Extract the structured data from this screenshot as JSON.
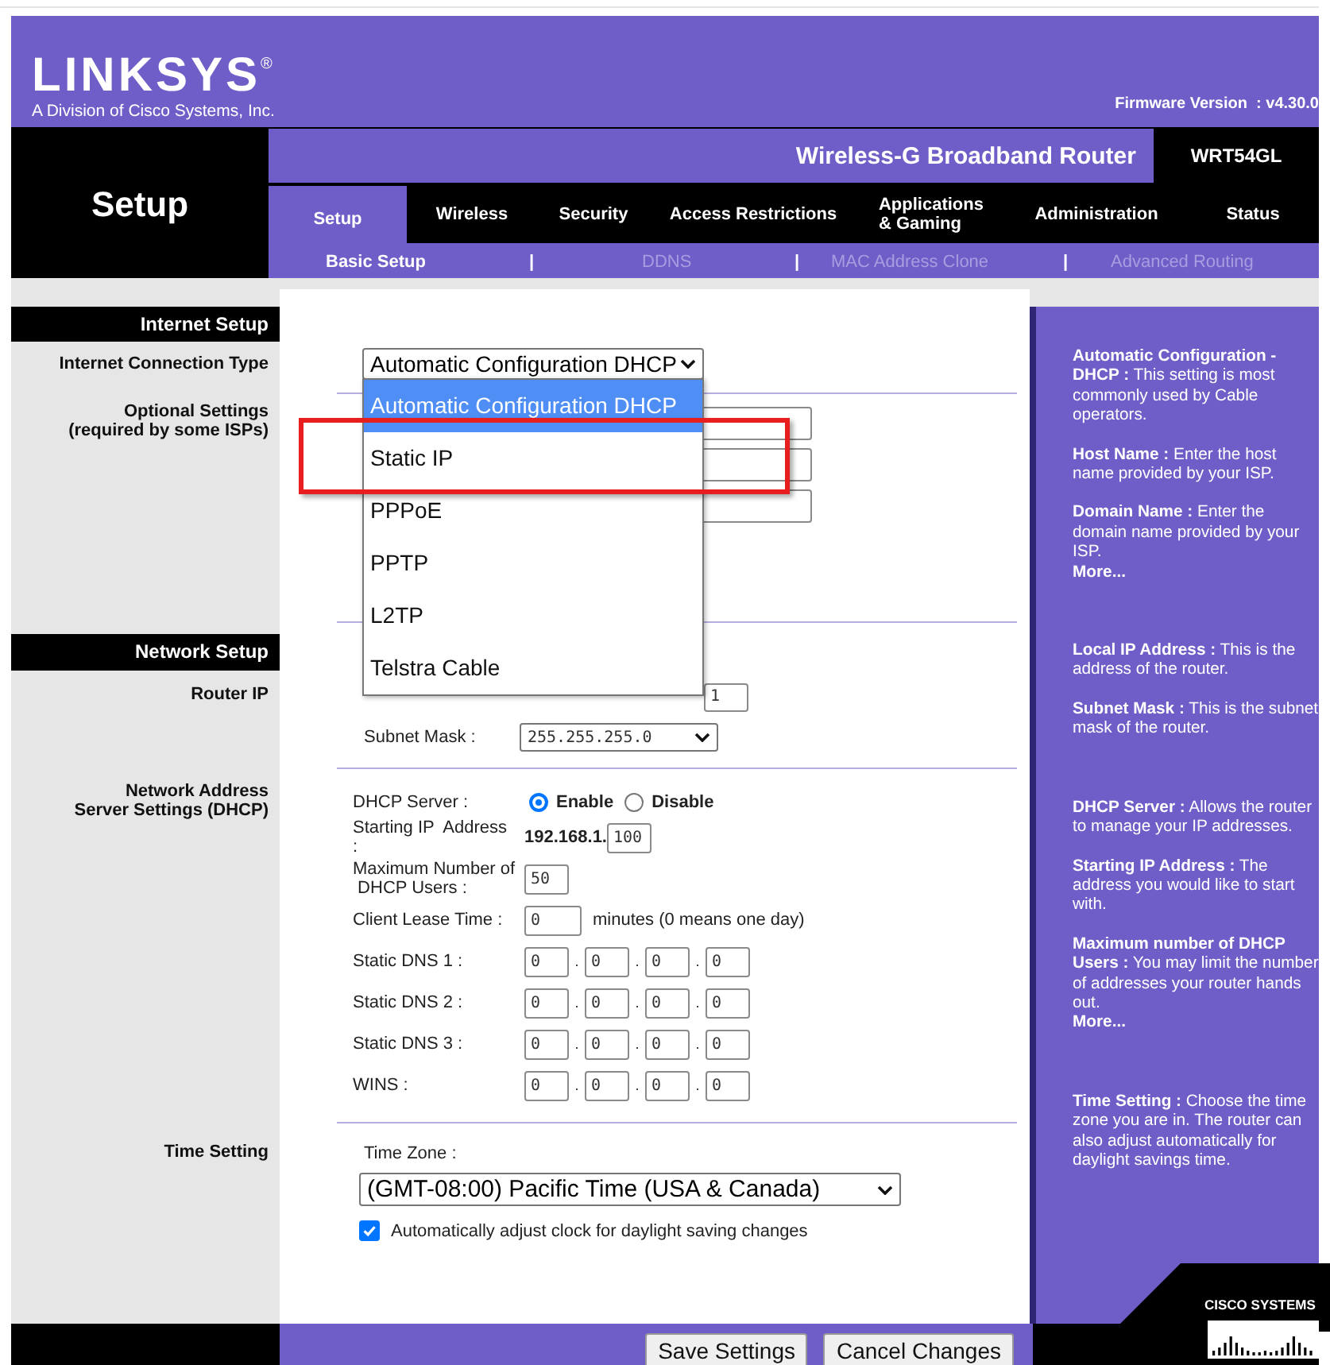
{
  "header": {
    "logo": "LINKSYS$^{®}$",
    "tagline": "A Division of Cisco Systems, Inc.",
    "firmware": "Firmware Version  : v4.30.0"
  },
  "page_title": "Setup",
  "product": {
    "name": "Wireless-G Broadband Router",
    "model": "WRT54GL"
  },
  "tabs": [
    {
      "label": "Setup",
      "selected": true
    },
    {
      "label": "Wireless",
      "selected": false
    },
    {
      "label": "Security",
      "selected": false
    },
    {
      "label": "Access Restrictions",
      "selected": false
    },
    {
      "label": "Applications\n& Gaming",
      "selected": false
    },
    {
      "label": "Administration",
      "selected": false
    },
    {
      "label": "Status",
      "selected": false
    }
  ],
  "subtabs": [
    {
      "label": "Basic Setup",
      "selected": true
    },
    {
      "label": "DDNS",
      "selected": false
    },
    {
      "label": "MAC Address Clone",
      "selected": false
    },
    {
      "label": "Advanced Routing",
      "selected": false
    }
  ],
  "subtab_separators": [
    "|",
    "|",
    "|"
  ],
  "internet_setup": {
    "heading": "Internet Setup",
    "connection_type_label": "Internet Connection Type",
    "optional_label": "Optional Settings\n(required by some ISPs)",
    "connection_type": {
      "value": "Automatic Configuration DHCP",
      "expanded": true,
      "options": [
        {
          "label": "Automatic Configuration DHCP",
          "selected": true
        },
        {
          "label": "Static IP",
          "selected": false
        },
        {
          "label": "PPPoE",
          "selected": false
        },
        {
          "label": "PPTP",
          "selected": false
        },
        {
          "label": "L2TP",
          "selected": false
        },
        {
          "label": "Telstra Cable",
          "selected": false
        }
      ]
    },
    "optional_fields": [
      {
        "kind": "text"
      },
      {
        "kind": "text"
      },
      {
        "kind": "text"
      }
    ]
  },
  "annotation": {
    "kind": "rectangle"
  },
  "network_setup": {
    "heading": "Network Setup",
    "router_ip_label": "Router IP",
    "local_ip_last_octet": "1",
    "subnet_mask": {
      "label": "Subnet Mask :",
      "value": "255.255.255.0"
    }
  },
  "dhcp": {
    "label": "Network Address\nServer Settings (DHCP)",
    "rows": [
      {
        "kind": "radio",
        "label": "DHCP Server :",
        "options": [
          {
            "label": "Enable",
            "selected": true
          },
          {
            "label": "Disable",
            "selected": false
          }
        ]
      },
      {
        "kind": "prefixed",
        "label": "Starting IP  Address\n:",
        "prefix": "192.168.1.",
        "value": "100"
      },
      {
        "kind": "field",
        "label": "Maximum Number of\n DHCP Users :",
        "value": "50"
      },
      {
        "kind": "field",
        "label": "Client Lease Time :",
        "value": "0",
        "suffix": "minutes (0 means one day)"
      },
      {
        "kind": "ip",
        "label": "Static DNS 1 :",
        "octets": [
          "0",
          "0",
          "0",
          "0"
        ],
        "dots": [
          ".",
          ".",
          "."
        ]
      },
      {
        "kind": "ip",
        "label": "Static DNS 2 :",
        "octets": [
          "0",
          "0",
          "0",
          "0"
        ],
        "dots": [
          ".",
          ".",
          "."
        ]
      },
      {
        "kind": "ip",
        "label": "Static DNS 3 :",
        "octets": [
          "0",
          "0",
          "0",
          "0"
        ],
        "dots": [
          ".",
          ".",
          "."
        ]
      },
      {
        "kind": "ip",
        "label": "WINS :",
        "octets": [
          "0",
          "0",
          "0",
          "0"
        ],
        "dots": [
          ".",
          ".",
          "."
        ]
      }
    ]
  },
  "time_setting": {
    "label": "Time Setting",
    "zone_label": "Time Zone :",
    "zone": "(GMT-08:00) Pacific Time (USA & Canada)",
    "auto_dst": {
      "label": "Automatically adjust clock for daylight saving changes",
      "checked": true
    }
  },
  "help": [
    [
      {
        "kind": "text",
        "text": "**Automatic Configuration - DHCP :** This setting is most commonly used by Cable operators."
      },
      {
        "kind": "text",
        "text": "**Host Name :** Enter the host name provided by your ISP."
      },
      {
        "kind": "text",
        "text": "**Domain Name :** Enter the domain name provided by your ISP."
      },
      {
        "kind": "link",
        "text": "More..."
      }
    ],
    [
      {
        "kind": "text",
        "text": "**Local IP Address :** This is the address of the router."
      },
      {
        "kind": "text",
        "text": "**Subnet Mask :** This is the subnet mask of the router."
      }
    ],
    [
      {
        "kind": "text",
        "text": "**DHCP Server :** Allows the router to manage your IP addresses."
      },
      {
        "kind": "text",
        "text": "**Starting IP Address :** The address you would like to start with."
      },
      {
        "kind": "text",
        "text": "**Maximum number of DHCP Users :** You may limit the number of addresses your router hands out."
      },
      {
        "kind": "link",
        "text": "More..."
      }
    ],
    [
      {
        "kind": "text",
        "text": "**Time Setting :** Choose the time zone you are in. The router can also adjust automatically for daylight savings time."
      }
    ]
  ],
  "buttons": [
    "Save Settings",
    "Cancel Changes"
  ],
  "cisco_logo": "CISCO SYSTEMS"
}
